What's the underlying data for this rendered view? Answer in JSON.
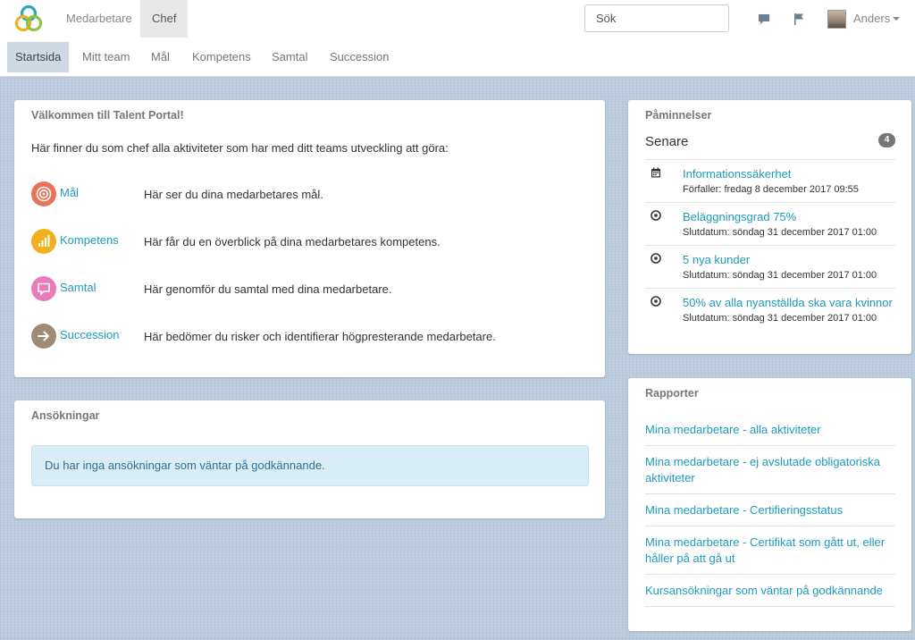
{
  "topnav": {
    "items": [
      "Medarbetare",
      "Chef"
    ],
    "search_placeholder": "Sök",
    "user": "Anders"
  },
  "subnav": {
    "items": [
      "Startsida",
      "Mitt team",
      "Mål",
      "Kompetens",
      "Samtal",
      "Succession"
    ]
  },
  "welcome": {
    "title": "Välkommen till Talent Portal!",
    "intro": "Här finner du som chef alla aktiviteter som har med ditt teams utveckling att göra:",
    "features": [
      {
        "link": "Mål",
        "desc": "Här ser du dina medarbetares mål.",
        "icon": "target-icon",
        "color": "#e8735a"
      },
      {
        "link": "Kompetens",
        "desc": "Här får du en överblick på dina medarbetares kompetens.",
        "icon": "bar-chart-icon",
        "color": "#f2b01e"
      },
      {
        "link": "Samtal",
        "desc": "Här genomför du samtal med dina medarbetare.",
        "icon": "chat-icon",
        "color": "#e87bb8"
      },
      {
        "link": "Succession",
        "desc": "Här bedömer du risker och identifierar högpresterande medarbetare.",
        "icon": "arrow-right-icon",
        "color": "#a08a78"
      }
    ]
  },
  "applications": {
    "title": "Ansökningar",
    "message": "Du har inga ansökningar som väntar på godkännande."
  },
  "reminders": {
    "title": "Påminnelser",
    "section": "Senare",
    "count": "4",
    "items": [
      {
        "title": "Informationssäkerhet",
        "sub": "Förfaller: fredag 8 december 2017 09:55",
        "icon": "calendar-icon"
      },
      {
        "title": "Beläggningsgrad 75%",
        "sub": "Slutdatum: söndag 31 december 2017 01:00",
        "icon": "target-icon"
      },
      {
        "title": "5 nya kunder",
        "sub": "Slutdatum: söndag 31 december 2017 01:00",
        "icon": "target-icon"
      },
      {
        "title": "50% av alla nyanställda ska vara kvinnor",
        "sub": "Slutdatum: söndag 31 december 2017 01:00",
        "icon": "target-icon"
      }
    ]
  },
  "reports": {
    "title": "Rapporter",
    "items": [
      "Mina medarbetare - alla aktiviteter",
      "Mina medarbetare - ej avslutade obligatoriska aktiviteter",
      "Mina medarbetare - Certifieringsstatus",
      "Mina medarbetare - Certifikat som gått ut, eller håller på att gå ut",
      "Kursansökningar som väntar på godkännande"
    ]
  }
}
